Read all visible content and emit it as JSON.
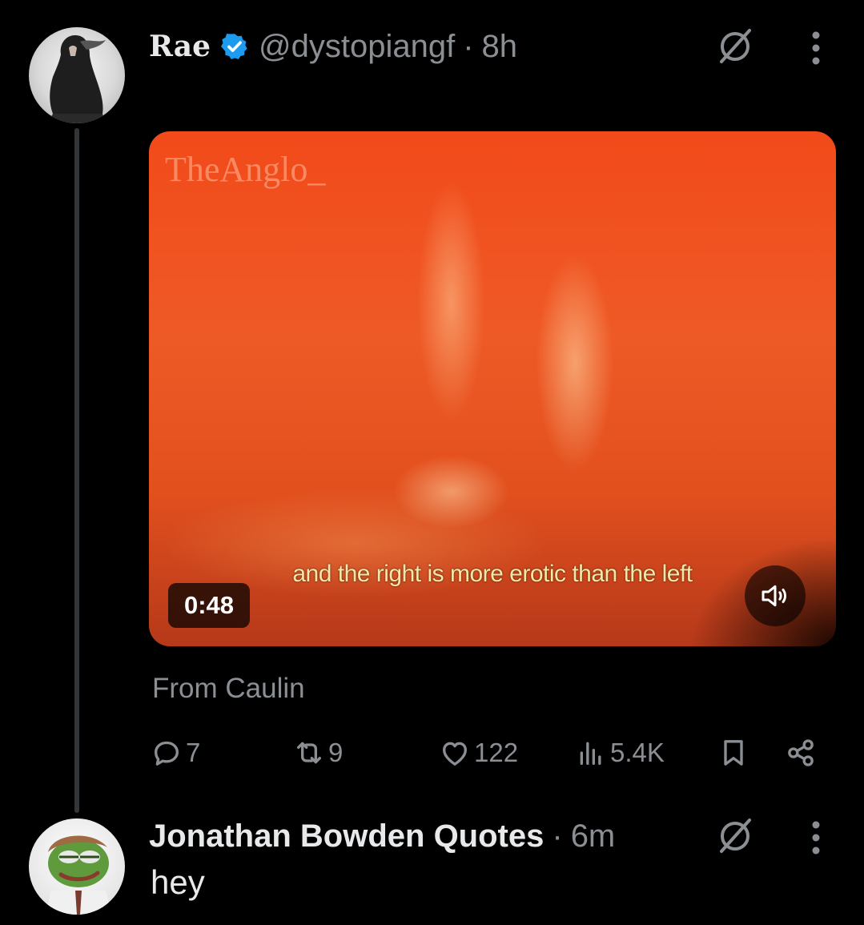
{
  "tweet": {
    "display_name": "Rae",
    "handle": "@dystopiangf",
    "separator": "·",
    "time": "8h",
    "media": {
      "watermark": "TheAnglo_",
      "caption": "and the right is more erotic than the left",
      "duration": "0:48"
    },
    "source_note": "From Caulin",
    "stats": {
      "replies": "7",
      "reposts": "9",
      "likes": "122",
      "views": "5.4K"
    }
  },
  "reply": {
    "display_name": "Jonathan Bowden Quotes",
    "separator": "·",
    "time": "6m",
    "text": "hey"
  },
  "colors": {
    "background": "#000000",
    "primary_text": "#e7e9ea",
    "secondary_text": "#8b8f94",
    "verified_blue": "#1d9bf0",
    "thread_line": "#333639"
  },
  "icons": {
    "verified": "verified-badge-icon",
    "grok": "grok-icon",
    "more": "more-icon",
    "mute": "volume-icon",
    "reply": "reply-icon",
    "repost": "repost-icon",
    "like": "heart-icon",
    "views": "views-icon",
    "bookmark": "bookmark-icon",
    "share": "share-icon"
  }
}
